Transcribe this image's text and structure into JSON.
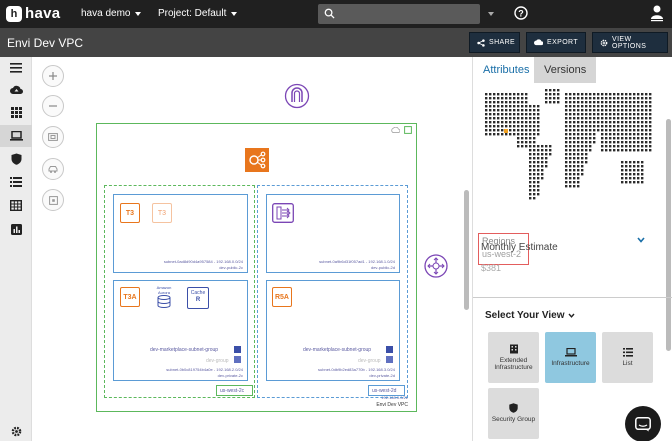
{
  "topbar": {
    "brand": "hava",
    "workspace": "hava demo",
    "project": "Project: Default",
    "search_placeholder": ""
  },
  "titlebar": {
    "title": "Envi Dev VPC",
    "share": "SHARE",
    "export": "EXPORT",
    "view_options": "VIEW OPTIONS"
  },
  "diagram": {
    "vpc_label": "Envi Dev VPC",
    "vpc_cidr": "192.168.0.0/22",
    "az_a": "us-west-2c",
    "az_b": "us-west-2d",
    "subnets": [
      {
        "id": "subnet-0ad8d90d4a957584 - 192.168.0.0/24",
        "name": "dev-public-2c"
      },
      {
        "id": "subnet-0a9b6d31f057ad1 - 192.168.1.0/24",
        "name": "dev-public-2d"
      },
      {
        "id": "subnet-0b0c819754b4a0e - 192.168.2.0/24",
        "name": "dev-private-2c"
      },
      {
        "id": "subnet-0db9b2ed83a770b - 192.168.3.0/24",
        "name": "dev-private-2d"
      }
    ],
    "t3": "T3",
    "t3a": "T3A",
    "r5a": "R5A",
    "aurora": "Amazon Aurora",
    "cache": "Cache",
    "cache_sub": "R",
    "db_group_a": "dev-marketplace-subnet-group",
    "db_group_b": "dev-marketplace-subnet-group",
    "dev_group_a": "dev-group",
    "dev_group_b": "dev-group"
  },
  "panel": {
    "tab_attributes": "Attributes",
    "tab_versions": "Versions",
    "regions_label": "Regions",
    "regions_value": "us-west-2",
    "estimate_label": "Monthly Estimate",
    "estimate_value": "$381",
    "select_view": "Select Your View",
    "views": [
      {
        "label": "Extended Infrastructure",
        "icon": "building-icon"
      },
      {
        "label": "Infrastructure",
        "icon": "laptop-icon"
      },
      {
        "label": "List",
        "icon": "list-icon"
      },
      {
        "label": "Security Group",
        "icon": "shield-icon"
      }
    ]
  },
  "colors": {
    "accent": "#1a6fa8",
    "selected_view": "#8fc8e0",
    "vpc_border": "#5cb85c",
    "subnet_border": "#5b9bd5",
    "aws_orange": "#e8761d",
    "region_marker": "#f0a020"
  }
}
